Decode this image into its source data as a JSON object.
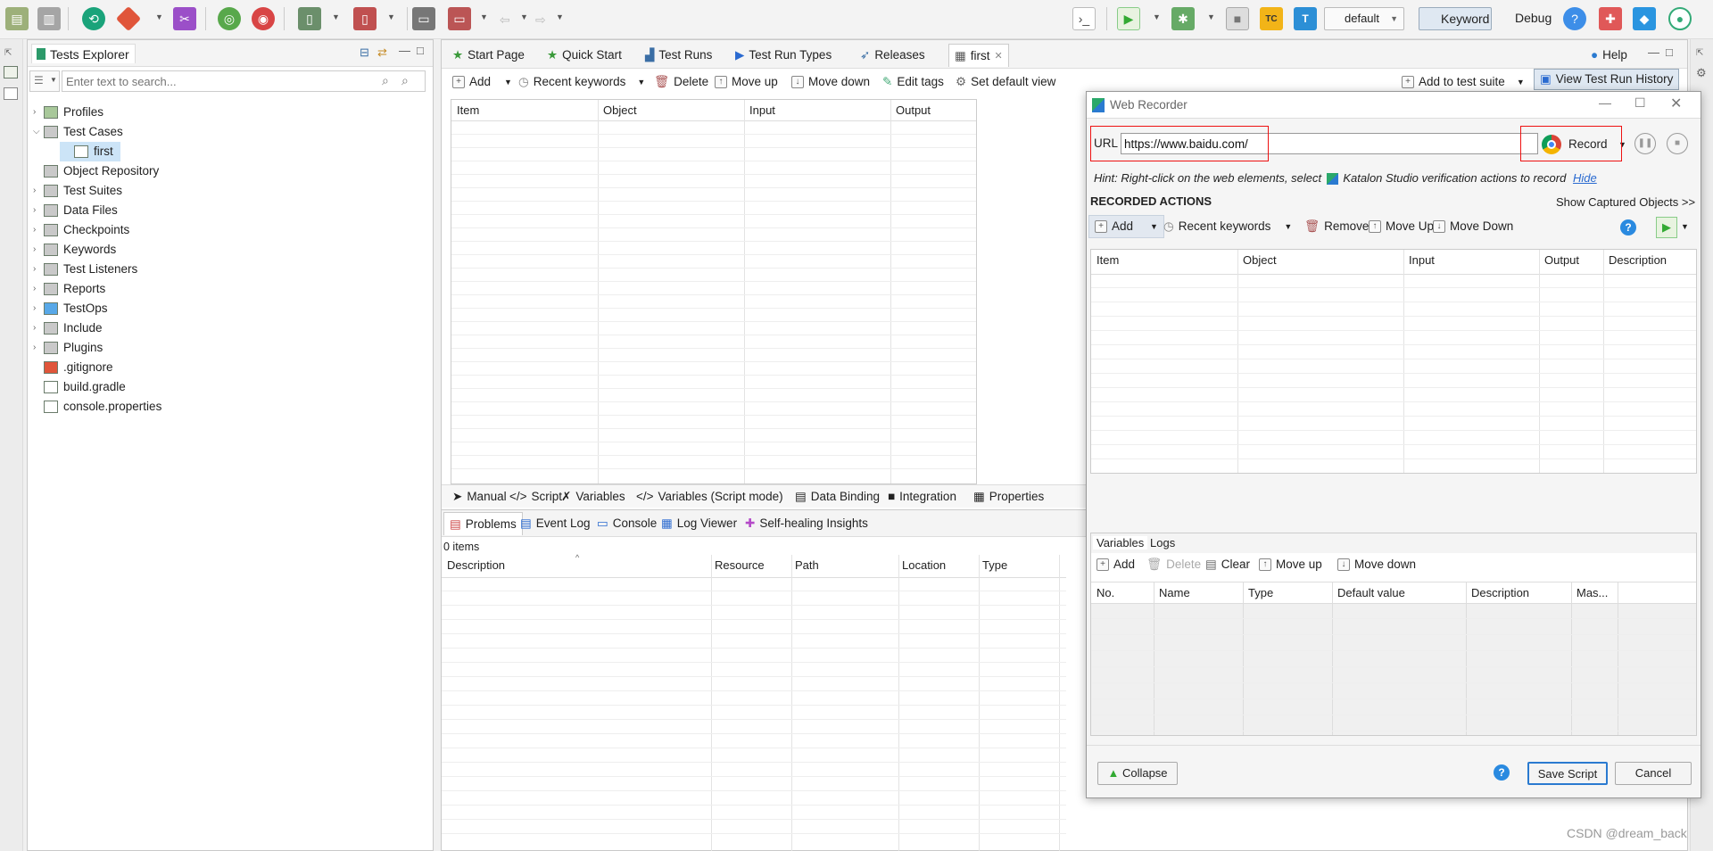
{
  "toolbar": {
    "profile": "default",
    "keyword": "Keyword",
    "debug": "Debug"
  },
  "explorer": {
    "title": "Tests Explorer",
    "search_placeholder": "Enter text to search...",
    "items": [
      {
        "label": "Profiles",
        "expandable": true,
        "indent": 0
      },
      {
        "label": "Test Cases",
        "expandable": true,
        "expanded": true,
        "indent": 0
      },
      {
        "label": "first",
        "expandable": false,
        "indent": 1,
        "selected": true
      },
      {
        "label": "Object Repository",
        "expandable": false,
        "indent": 0
      },
      {
        "label": "Test Suites",
        "expandable": true,
        "indent": 0
      },
      {
        "label": "Data Files",
        "expandable": true,
        "indent": 0
      },
      {
        "label": "Checkpoints",
        "expandable": true,
        "indent": 0
      },
      {
        "label": "Keywords",
        "expandable": true,
        "indent": 0
      },
      {
        "label": "Test Listeners",
        "expandable": true,
        "indent": 0
      },
      {
        "label": "Reports",
        "expandable": true,
        "indent": 0
      },
      {
        "label": "TestOps",
        "expandable": true,
        "indent": 0
      },
      {
        "label": "Include",
        "expandable": true,
        "indent": 0
      },
      {
        "label": "Plugins",
        "expandable": true,
        "indent": 0
      },
      {
        "label": ".gitignore",
        "expandable": false,
        "indent": 0
      },
      {
        "label": "build.gradle",
        "expandable": false,
        "indent": 0
      },
      {
        "label": "console.properties",
        "expandable": false,
        "indent": 0
      }
    ]
  },
  "editor": {
    "tabs": [
      "Start Page",
      "Quick Start",
      "Test Runs",
      "Test Run Types",
      "Releases",
      "first"
    ],
    "help": "Help",
    "actions": [
      "Add",
      "Recent keywords",
      "Delete",
      "Move up",
      "Move down",
      "Edit tags",
      "Set default view"
    ],
    "right_actions": [
      "Add to test suite",
      "View Test Run History"
    ],
    "columns": [
      "Item",
      "Object",
      "Input",
      "Output"
    ],
    "bottom_tabs": [
      "Manual",
      "Script",
      "Variables",
      "Variables (Script mode)",
      "Data Binding",
      "Integration",
      "Properties"
    ]
  },
  "problems": {
    "tabs": [
      "Problems",
      "Event Log",
      "Console",
      "Log Viewer",
      "Self-healing Insights"
    ],
    "count": "0 items",
    "columns": [
      "Description",
      "Resource",
      "Path",
      "Location",
      "Type"
    ]
  },
  "recorder": {
    "title": "Web Recorder",
    "url_label": "URL",
    "url_value": "https://www.baidu.com/",
    "record_label": "Record",
    "hint": "Hint: Right-click on the web elements, select",
    "hint2": "Katalon Studio verification actions to record",
    "hide": "Hide",
    "recorded_actions": "RECORDED ACTIONS",
    "show_captured": "Show Captured Objects >>",
    "actions": [
      "Add",
      "Recent keywords",
      "Remove",
      "Move Up",
      "Move Down"
    ],
    "columns": [
      "Item",
      "Object",
      "Input",
      "Output",
      "Description"
    ],
    "var_tabs": [
      "Variables",
      "Logs"
    ],
    "var_actions": [
      "Add",
      "Delete",
      "Clear",
      "Move up",
      "Move down"
    ],
    "var_columns": [
      "No.",
      "Name",
      "Type",
      "Default value",
      "Description",
      "Mas..."
    ],
    "collapse": "Collapse",
    "save_script": "Save Script",
    "cancel": "Cancel"
  },
  "watermark": "CSDN @dream_back"
}
